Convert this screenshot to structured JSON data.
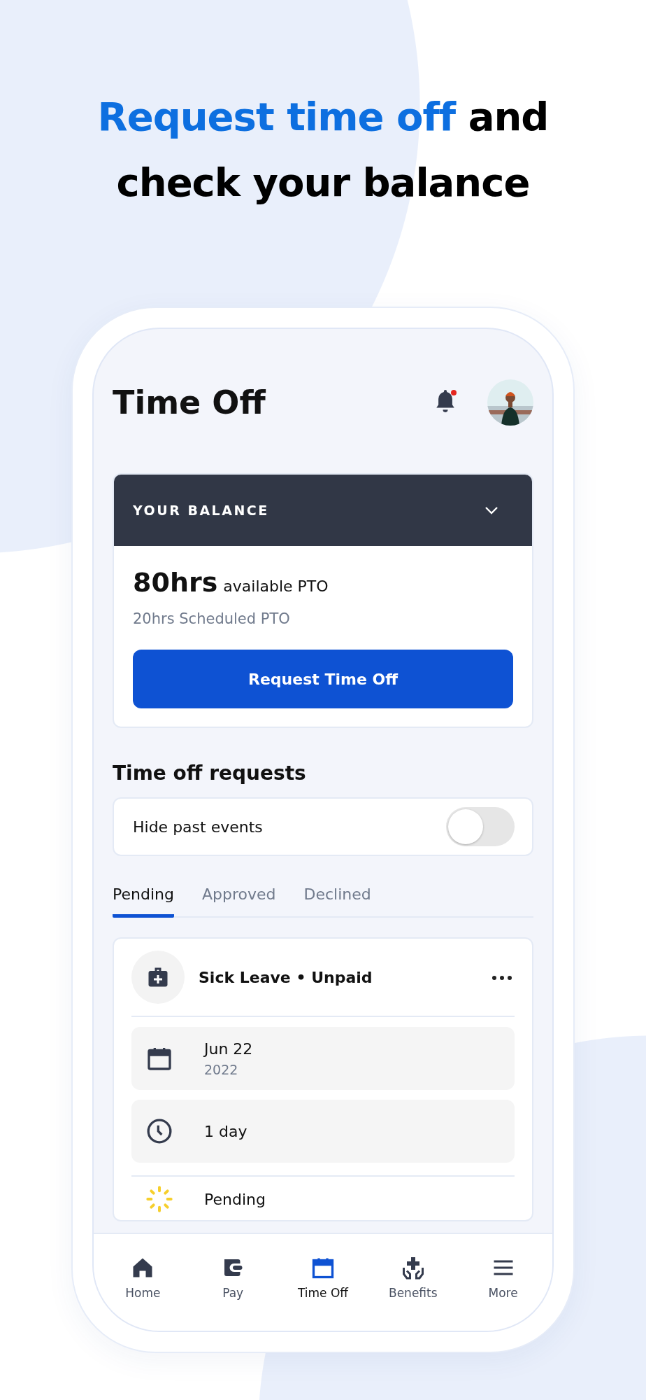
{
  "headline": {
    "highlight": "Request time off",
    "rest": "and check your balance"
  },
  "screen": {
    "title": "Time Off",
    "notifications": {
      "unread": true
    },
    "balance": {
      "heading": "YOUR BALANCE",
      "expanded": false,
      "amount": "80hrs",
      "amount_label": "available PTO",
      "scheduled": "20hrs Scheduled PTO",
      "button": "Request Time Off"
    },
    "requests": {
      "heading": "Time off requests",
      "toggle": {
        "label": "Hide past events",
        "on": false
      },
      "tabs": [
        {
          "label": "Pending",
          "selected": true
        },
        {
          "label": "Approved",
          "selected": false
        },
        {
          "label": "Declined",
          "selected": false
        }
      ],
      "card": {
        "title": "Sick Leave • Unpaid",
        "details": [
          {
            "kind": "date",
            "text": "Jun 22",
            "subtext": "2022"
          },
          {
            "kind": "duration",
            "text": "1 day"
          }
        ],
        "status": {
          "kind": "pending",
          "text": "Pending"
        }
      }
    },
    "nav": [
      {
        "kind": "home",
        "label": "Home",
        "selected": false
      },
      {
        "kind": "pay",
        "label": "Pay",
        "selected": false
      },
      {
        "kind": "timeoff",
        "label": "Time Off",
        "selected": true
      },
      {
        "kind": "benefits",
        "label": "Benefits",
        "selected": false
      },
      {
        "kind": "more",
        "label": "More",
        "selected": false
      }
    ]
  }
}
